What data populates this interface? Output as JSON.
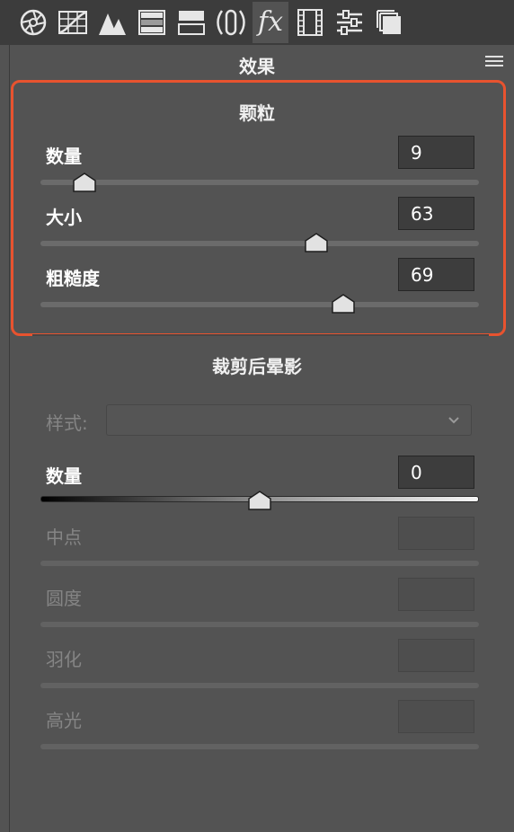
{
  "panel_title": "效果",
  "toolbar": {
    "tools": [
      "aperture-icon",
      "grid-curve-icon",
      "mountains-icon",
      "gradient-bars-icon",
      "split-toning-icon",
      "lens-icon",
      "fx-icon",
      "film-strip-icon",
      "sliders-icon",
      "layers-icon"
    ],
    "active_tool": "fx-icon",
    "fx_label": "fx"
  },
  "grain": {
    "title": "颗粒",
    "amount": {
      "label": "数量",
      "value": "9",
      "level": 0.1
    },
    "size": {
      "label": "大小",
      "value": "63",
      "level": 0.63
    },
    "roughness": {
      "label": "粗糙度",
      "value": "69",
      "level": 0.69
    }
  },
  "vignette": {
    "title": "裁剪后晕影",
    "style": {
      "label": "样式:",
      "value": ""
    },
    "amount": {
      "label": "数量",
      "value": "0",
      "level": 0.5
    },
    "midpoint": {
      "label": "中点",
      "value": ""
    },
    "roundness": {
      "label": "圆度",
      "value": ""
    },
    "feather": {
      "label": "羽化",
      "value": ""
    },
    "highlights": {
      "label": "高光",
      "value": ""
    }
  },
  "colors": {
    "highlight_border": "#e8532f",
    "panel_bg": "#535353",
    "toolbar_bg": "#3c3c3c"
  }
}
